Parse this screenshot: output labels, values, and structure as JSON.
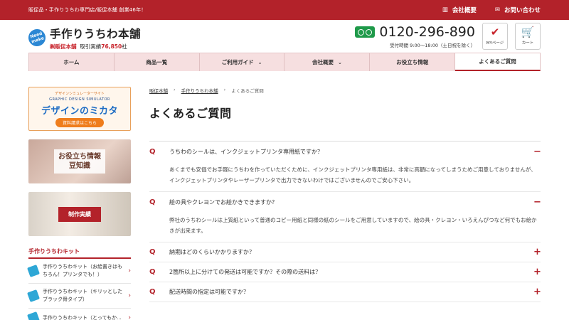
{
  "topbar": {
    "tagline": "販促品・手作りうちわ専門店/販促本舗 創業46年！",
    "company_label": "会社概要",
    "contact_label": "お問い合わせ"
  },
  "header": {
    "badge": "Need make",
    "shop_name": "手作りうちわ本舗",
    "sub_brand": "㈱販促本舗",
    "record_label": "取引実績",
    "record_count": "76,850",
    "record_unit": "社",
    "phone": "0120-296-890",
    "hours": "受付時間 9:00～18:00（土日祝を除く）",
    "mypage_label": "MYページ",
    "cart_label": "カート"
  },
  "nav": [
    {
      "label": "ホーム",
      "chevron": false
    },
    {
      "label": "商品一覧",
      "chevron": false
    },
    {
      "label": "ご利用ガイド",
      "chevron": true
    },
    {
      "label": "会社概要",
      "chevron": true
    },
    {
      "label": "お役立ち情報",
      "chevron": false
    },
    {
      "label": "よくあるご質問",
      "chevron": false,
      "active": true
    }
  ],
  "sidebar": {
    "banner1": {
      "line1": "デザインシミュレーターサイト",
      "line2": "GRAPHIC DESIGN SIMULATOR",
      "title": "デザインのミカタ",
      "button": "資料請求はこちら"
    },
    "banner2": {
      "line1": "お役立ち情報",
      "line2": "豆知識"
    },
    "banner3": {
      "label": "制作実績"
    },
    "kit_heading": "手作りうちわキット",
    "kits": [
      {
        "label": "手作りうちわキット（お絵書きはもちろん！プリンタでも！）"
      },
      {
        "label": "手作りうちわキット（キリッとしたブラック骨タイプ）"
      },
      {
        "label": "手作りうちわキット（とってもか..."
      }
    ]
  },
  "breadcrumb": {
    "home": "販促本舗",
    "parent": "手作りうちわ本舗",
    "current": "よくあるご質問"
  },
  "page_title": "よくあるご質問",
  "faq": [
    {
      "q": "うちわのシールは、インクジェットプリンタ専用紙ですか？",
      "a": "あくまでも安価でお手軽にうちわを作っていただくために、インクジェットプリンタ専用紙は、非常に高額になってしまうためご用意しておりませんが、インクジェットプリンタやレーザープリンタで出力できないわけではございませんのでご安心下さい。",
      "open": true
    },
    {
      "q": "絵の具やクレヨンでお絵かきできますか？",
      "a": "弊社のうちわシールは上質紙といって普通のコピー用紙と同様の紙のシールをご用意していますので、絵の具・クレヨン・いろえんぴつなど何でもお絵かきが出来ます。",
      "open": true
    },
    {
      "q": "納期はどのくらいかかりますか？",
      "a": "",
      "open": false
    },
    {
      "q": "2箇所以上に分けての発送は可能ですか？その際の送料は？",
      "a": "",
      "open": false
    },
    {
      "q": "配送時間の指定は可能ですか？",
      "a": "",
      "open": false
    }
  ],
  "faq_marker": "Q",
  "colors": {
    "brand": "#b3222a",
    "accent_blue": "#2b87d4",
    "phone_green": "#1f9a4a"
  }
}
